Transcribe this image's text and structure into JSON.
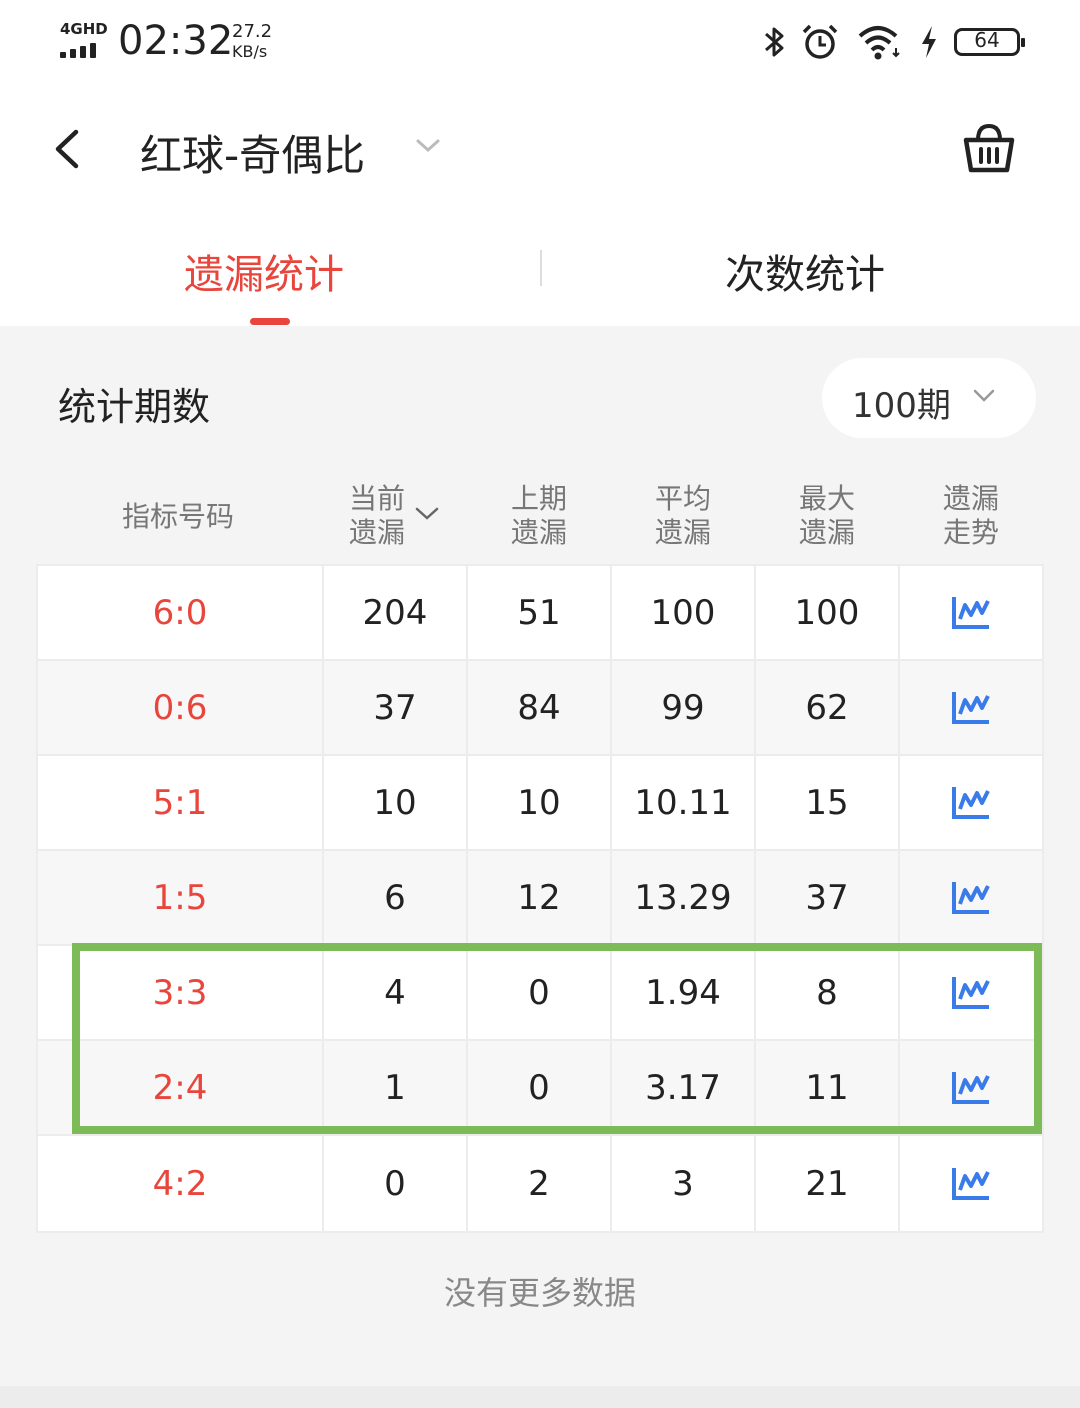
{
  "status_bar": {
    "network": "4GHD",
    "time": "02:32",
    "speed_value": "27.2",
    "speed_unit": "KB/s",
    "battery": "64"
  },
  "header": {
    "title": "红球-奇偶比"
  },
  "tabs": [
    {
      "label": "遗漏统计",
      "active": true
    },
    {
      "label": "次数统计",
      "active": false
    }
  ],
  "period": {
    "label": "统计期数",
    "value": "100期"
  },
  "table": {
    "columns": [
      {
        "l1": "指标号码",
        "l2": ""
      },
      {
        "l1": "当前",
        "l2": "遗漏"
      },
      {
        "l1": "上期",
        "l2": "遗漏"
      },
      {
        "l1": "平均",
        "l2": "遗漏"
      },
      {
        "l1": "最大",
        "l2": "遗漏"
      },
      {
        "l1": "遗漏",
        "l2": "走势"
      }
    ],
    "rows": [
      {
        "ratio": "6:0",
        "current": "204",
        "previous": "51",
        "average": "100",
        "max": "100"
      },
      {
        "ratio": "0:6",
        "current": "37",
        "previous": "84",
        "average": "99",
        "max": "62"
      },
      {
        "ratio": "5:1",
        "current": "10",
        "previous": "10",
        "average": "10.11",
        "max": "15"
      },
      {
        "ratio": "1:5",
        "current": "6",
        "previous": "12",
        "average": "13.29",
        "max": "37"
      },
      {
        "ratio": "3:3",
        "current": "4",
        "previous": "0",
        "average": "1.94",
        "max": "8"
      },
      {
        "ratio": "2:4",
        "current": "1",
        "previous": "0",
        "average": "3.17",
        "max": "11"
      },
      {
        "ratio": "4:2",
        "current": "0",
        "previous": "2",
        "average": "3",
        "max": "21"
      }
    ]
  },
  "footer": {
    "no_more": "没有更多数据"
  },
  "colors": {
    "accent_red": "#e8453c",
    "trend_blue": "#3a7bea",
    "highlight_green": "#7cbb58"
  },
  "icons": [
    "back-arrow-icon",
    "chevron-down-icon",
    "basket-icon",
    "trend-chart-icon",
    "bluetooth-icon",
    "alarm-icon",
    "wifi-icon",
    "charging-icon",
    "battery-icon"
  ]
}
